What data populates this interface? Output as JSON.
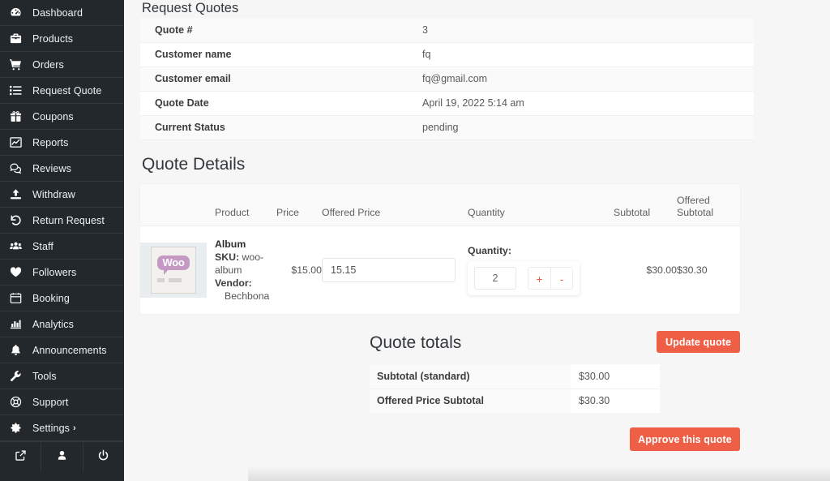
{
  "sidebar": {
    "items": [
      {
        "label": "Dashboard",
        "icon": "gauge-icon"
      },
      {
        "label": "Products",
        "icon": "briefcase-icon"
      },
      {
        "label": "Orders",
        "icon": "cart-icon"
      },
      {
        "label": "Request Quote",
        "icon": "list-icon"
      },
      {
        "label": "Coupons",
        "icon": "gift-icon"
      },
      {
        "label": "Reports",
        "icon": "chart-line-icon"
      },
      {
        "label": "Reviews",
        "icon": "comments-icon"
      },
      {
        "label": "Withdraw",
        "icon": "upload-icon"
      },
      {
        "label": "Return Request",
        "icon": "undo-icon"
      },
      {
        "label": "Staff",
        "icon": "users-icon"
      },
      {
        "label": "Followers",
        "icon": "heart-icon"
      },
      {
        "label": "Booking",
        "icon": "calendar-icon"
      },
      {
        "label": "Analytics",
        "icon": "bar-chart-icon"
      },
      {
        "label": "Announcements",
        "icon": "bell-icon"
      },
      {
        "label": "Tools",
        "icon": "wrench-icon"
      },
      {
        "label": "Support",
        "icon": "lifebuoy-icon"
      },
      {
        "label": "Settings",
        "icon": "gear-icon",
        "chevron": "›"
      }
    ],
    "footer": [
      {
        "icon": "external-link-icon"
      },
      {
        "icon": "user-icon"
      },
      {
        "icon": "power-icon"
      }
    ]
  },
  "page": {
    "title": "Request Quotes",
    "info_rows": [
      {
        "key": "Quote #",
        "value": "3"
      },
      {
        "key": "Customer name",
        "value": "fq"
      },
      {
        "key": "Customer email",
        "value": "fq@gmail.com"
      },
      {
        "key": "Quote Date",
        "value": "April 19, 2022 5:14 am"
      },
      {
        "key": "Current Status",
        "value": "pending"
      }
    ],
    "details_title": "Quote Details",
    "details_headers": {
      "thumb": "",
      "product": "Product",
      "price": "Price",
      "offered_price": "Offered Price",
      "quantity": "Quantity",
      "subtotal": "Subtotal",
      "offered_subtotal": "Offered Subtotal"
    },
    "line_item": {
      "thumb_text": "Woo",
      "product_name": "Album",
      "sku_label": "SKU:",
      "sku_value": "woo-album",
      "vendor_label": "Vendor:",
      "vendor_value": "Bechbona",
      "price": "$15.00",
      "offered_price_value": "15.15",
      "quantity_label": "Quantity:",
      "quantity_value": "2",
      "plus_label": "+",
      "minus_label": "-",
      "subtotal": "$30.00",
      "offered_subtotal": "$30.30"
    },
    "totals_title": "Quote totals",
    "update_button": "Update quote",
    "totals_rows": [
      {
        "key": "Subtotal (standard)",
        "value": "$30.00"
      },
      {
        "key": "Offered Price Subtotal",
        "value": "$30.30"
      }
    ],
    "approve_button": "Approve this quote"
  },
  "colors": {
    "accent": "#ee5f46",
    "sidebar_bg": "#23282d",
    "page_bg": "#f6f6f6"
  }
}
